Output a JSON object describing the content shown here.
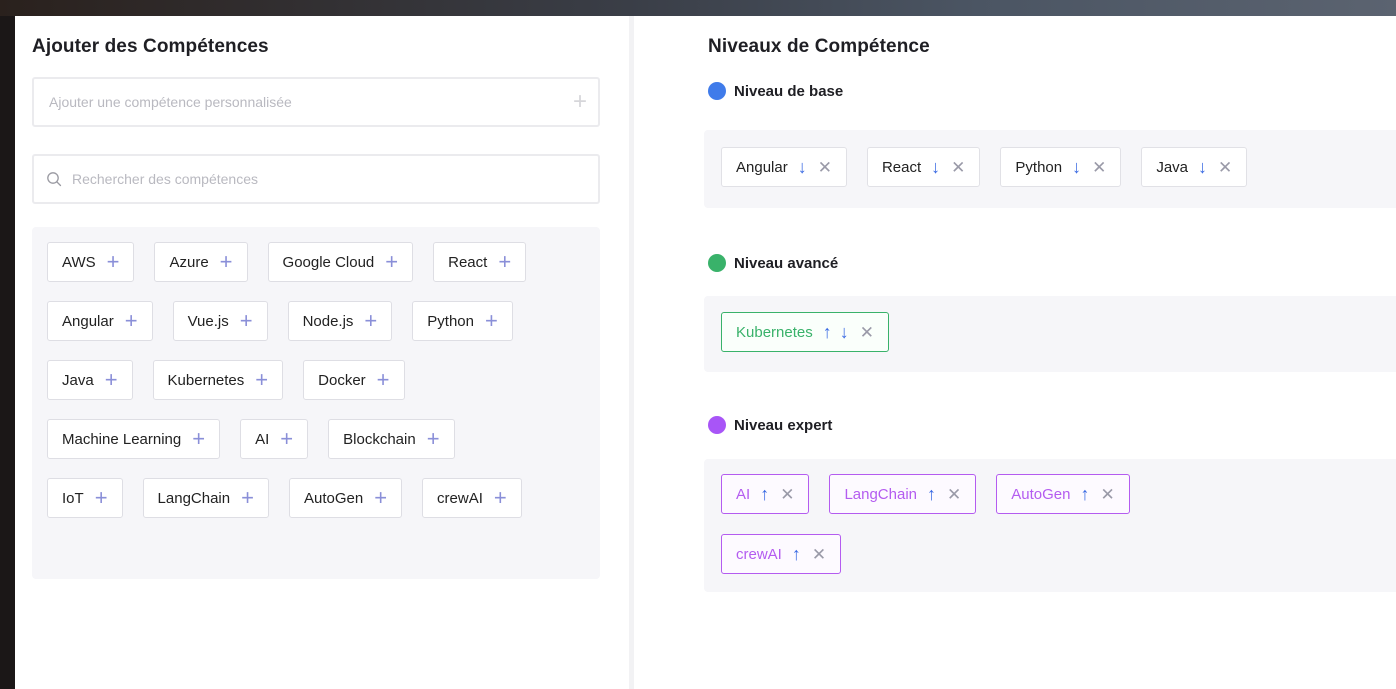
{
  "left": {
    "title": "Ajouter des Compétences",
    "custom_placeholder": "Ajouter une compétence personnalisée",
    "search_placeholder": "Rechercher des compétences",
    "suggestions": [
      [
        "AWS",
        "Azure",
        "Google Cloud",
        "React"
      ],
      [
        "Angular",
        "Vue.js",
        "Node.js",
        "Python"
      ],
      [
        "Java",
        "Kubernetes",
        "Docker"
      ],
      [
        "Machine Learning",
        "AI",
        "Blockchain"
      ],
      [
        "IoT",
        "LangChain",
        "AutoGen",
        "crewAI"
      ]
    ],
    "plus_glyph": "+"
  },
  "right": {
    "title": "Niveaux de Compétence",
    "levels": {
      "base": {
        "label": "Niveau de base",
        "color": "#3f7bea",
        "skills": [
          "Angular",
          "React",
          "Python",
          "Java"
        ]
      },
      "advanced": {
        "label": "Niveau avancé",
        "color": "#39b26a",
        "skills": [
          "Kubernetes"
        ]
      },
      "expert": {
        "label": "Niveau expert",
        "color": "#a855f7",
        "skills": [
          "AI",
          "LangChain",
          "AutoGen",
          "crewAI"
        ]
      }
    },
    "icons": {
      "up": "arrow-up-icon",
      "down": "arrow-down-icon",
      "remove": "close-icon"
    }
  }
}
